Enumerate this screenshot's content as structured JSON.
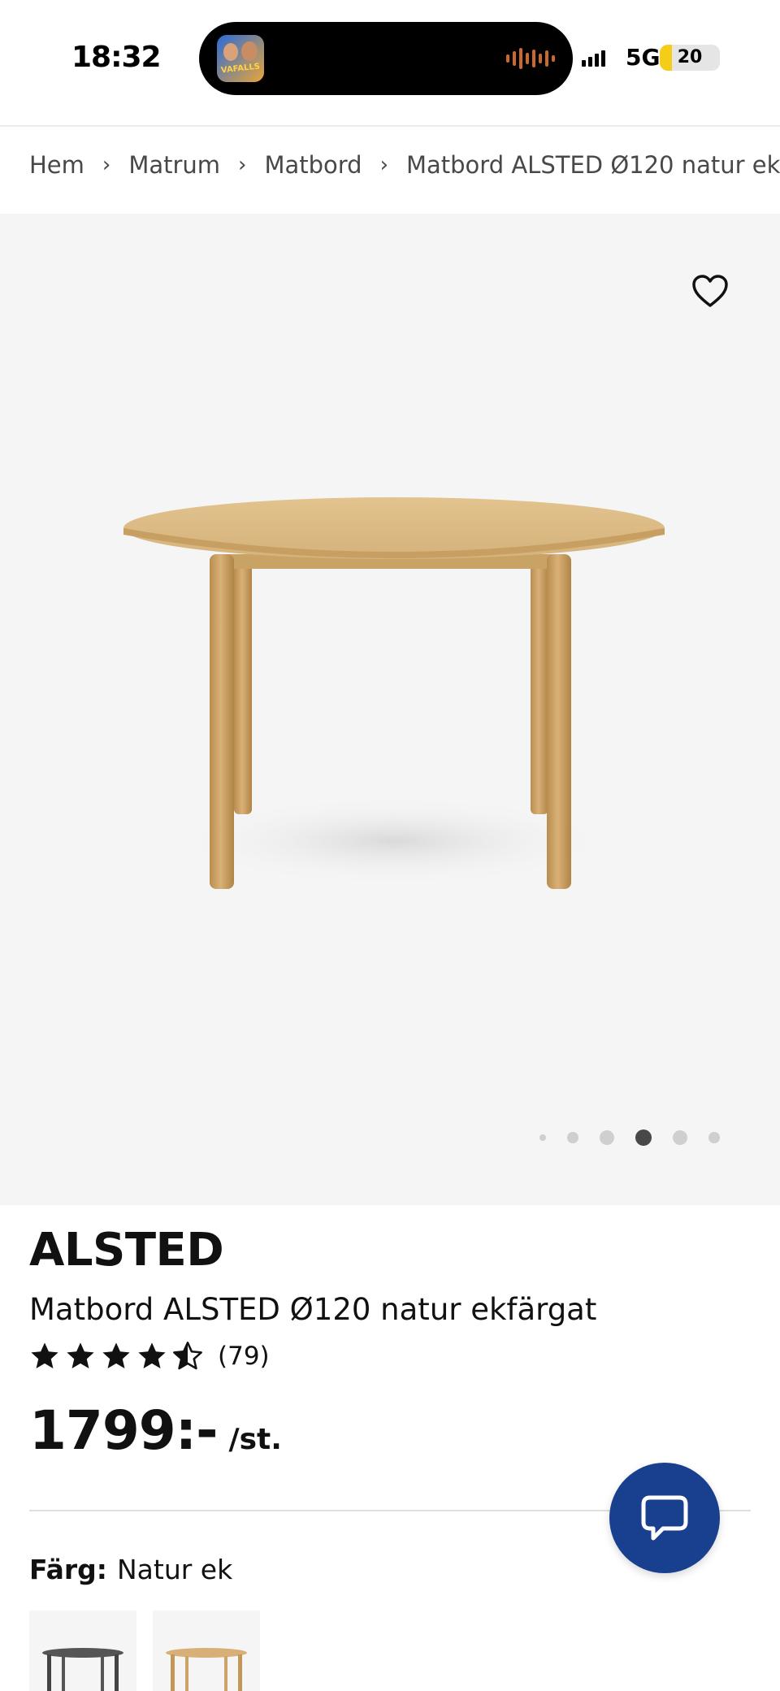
{
  "status_bar": {
    "time": "18:32",
    "app_badge_text": "VAFALLS",
    "network": "5G",
    "battery": "20",
    "battery_level_percent": 20
  },
  "breadcrumb": {
    "items": [
      "Hem",
      "Matrum",
      "Matbord",
      "Matbord ALSTED Ø120 natur ek"
    ]
  },
  "gallery": {
    "favorite_icon": "heart-outline-icon",
    "dot_count": 6,
    "active_dot_index": 3,
    "background": "#f5f5f5"
  },
  "product": {
    "name": "ALSTED",
    "description": "Matbord ALSTED Ø120 natur ekfärgat",
    "rating_stars": 4.5,
    "rating_count": "(79)",
    "price": "1799:-",
    "price_unit": "/st."
  },
  "color": {
    "label": "Färg:",
    "value": "Natur ek",
    "swatches": [
      "black-table",
      "oak-table"
    ]
  },
  "chat": {
    "icon": "chat-bubble-icon",
    "color": "#18408f"
  }
}
